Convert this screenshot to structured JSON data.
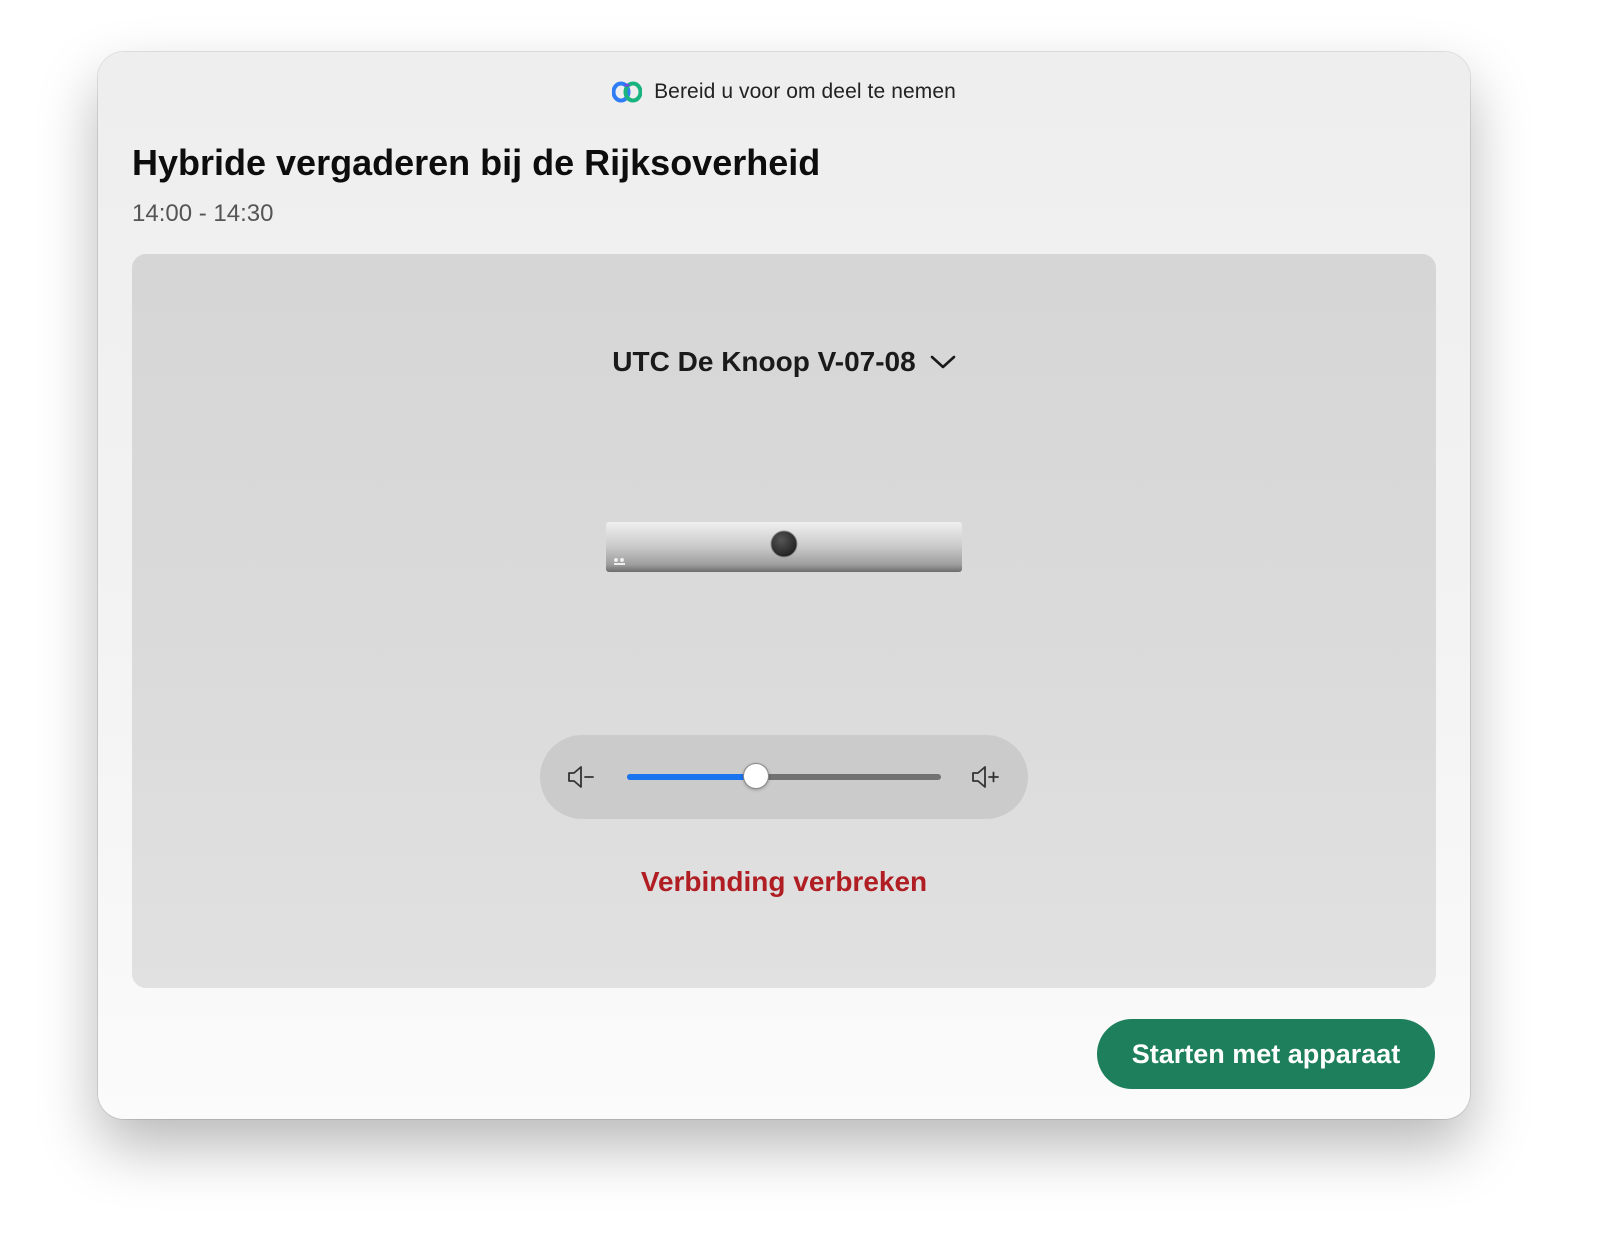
{
  "window": {
    "title": "Bereid u voor om deel te nemen",
    "logo_icon": "webex-logo-icon"
  },
  "meeting": {
    "title": "Hybride vergaderen bij de Rijksoverheid",
    "time": "14:00 - 14:30"
  },
  "device": {
    "selected_name": "UTC De Knoop V-07-08",
    "dropdown_icon": "chevron-down-icon",
    "image": "video-bar-device-image"
  },
  "volume": {
    "level": 0.41,
    "decrease_icon": "volume-down-icon",
    "increase_icon": "volume-up-icon"
  },
  "actions": {
    "disconnect_label": "Verbinding verbreken",
    "start_label": "Starten met apparaat"
  },
  "colors": {
    "accent_blue": "#1a74f0",
    "disconnect_red": "#b01e24",
    "primary_green": "#1e7f5c"
  }
}
